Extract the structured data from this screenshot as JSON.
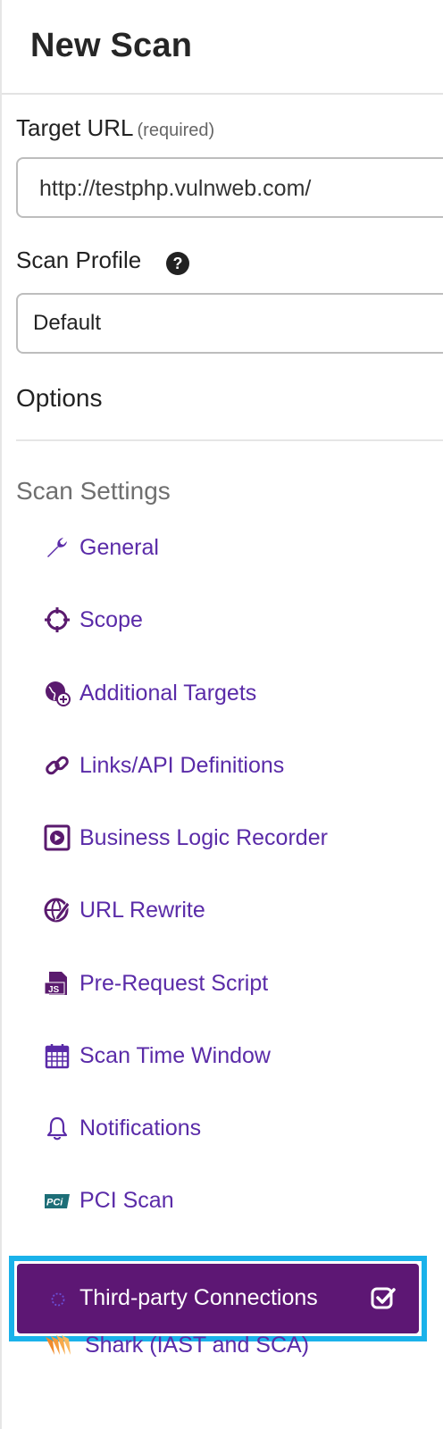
{
  "header": {
    "title": "New Scan"
  },
  "target_url": {
    "label": "Target URL",
    "required_note": "(required)",
    "value": "http://testphp.vulnweb.com/"
  },
  "scan_profile": {
    "label": "Scan Profile",
    "help_icon": "question-circle-icon",
    "selected": "Default"
  },
  "options": {
    "label": "Options"
  },
  "scan_settings": {
    "title": "Scan Settings",
    "items": [
      {
        "label": "General",
        "icon": "wrench-icon"
      },
      {
        "label": "Scope",
        "icon": "crosshair-icon"
      },
      {
        "label": "Additional Targets",
        "icon": "globe-plus-icon"
      },
      {
        "label": "Links/API Definitions",
        "icon": "link-icon"
      },
      {
        "label": "Business Logic Recorder",
        "icon": "play-square-icon"
      },
      {
        "label": "URL Rewrite",
        "icon": "globe-edit-icon"
      },
      {
        "label": "Pre-Request Script",
        "icon": "js-file-icon"
      },
      {
        "label": "Scan Time Window",
        "icon": "calendar-icon"
      },
      {
        "label": "Notifications",
        "icon": "bell-icon"
      },
      {
        "label": "PCI Scan",
        "icon": "pci-icon"
      },
      {
        "label": "Third-party Connections",
        "icon": "dotted-circle-icon",
        "selected": true,
        "checked": true
      },
      {
        "label": "Shark (IAST and SCA)",
        "icon": "shark-icon"
      }
    ]
  },
  "colors": {
    "accent": "#5a2ba8",
    "selected_bg": "#5d1774",
    "highlight_outline": "#1ab2ea"
  }
}
